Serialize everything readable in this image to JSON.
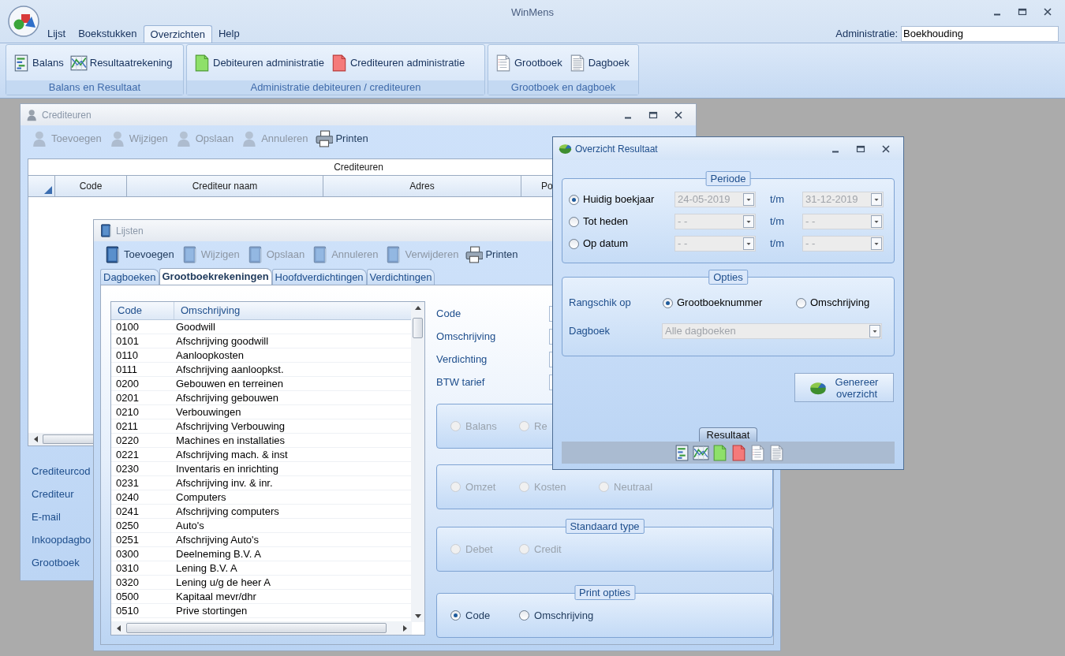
{
  "app": {
    "title": "WinMens"
  },
  "menu": [
    {
      "label": "Lijst",
      "selected": false
    },
    {
      "label": "Boekstukken",
      "selected": false
    },
    {
      "label": "Overzichten",
      "selected": true
    },
    {
      "label": "Help",
      "selected": false
    }
  ],
  "administratie": {
    "label": "Administratie:",
    "value": "Boekhouding"
  },
  "ribbon": [
    {
      "title": "Balans en Resultaat",
      "buttons": [
        {
          "label": "Balans",
          "kind": "ledger"
        },
        {
          "label": "Resultaatrekening",
          "kind": "chart"
        }
      ]
    },
    {
      "title": "Administratie debiteuren / crediteuren",
      "buttons": [
        {
          "label": "Debiteuren administratie",
          "kind": "green-doc"
        },
        {
          "label": "Crediteuren administratie",
          "kind": "red-doc"
        }
      ]
    },
    {
      "title": "Grootboek en dagboek",
      "buttons": [
        {
          "label": "Grootboek",
          "kind": "list-doc"
        },
        {
          "label": "Dagboek",
          "kind": "text-doc"
        }
      ]
    }
  ],
  "crediteuren_window": {
    "title": "Crediteuren",
    "toolbar": [
      {
        "label": "Toevoegen",
        "kind": "person",
        "disabled": true
      },
      {
        "label": "Wijzigen",
        "kind": "person",
        "disabled": true
      },
      {
        "label": "Opslaan",
        "kind": "person",
        "disabled": true
      },
      {
        "label": "Annuleren",
        "kind": "person",
        "disabled": true
      },
      {
        "label": "Printen",
        "kind": "printer",
        "disabled": false
      }
    ],
    "grid": {
      "title": "Crediteuren",
      "columns": [
        "Code",
        "Crediteur naam",
        "Adres",
        "Po"
      ]
    },
    "fields": [
      "Crediteurcod",
      "Crediteur",
      "E-mail",
      "Inkoopdagbo",
      "Grootboek"
    ]
  },
  "lijsten_window": {
    "title": "Lijsten",
    "toolbar": [
      {
        "label": "Toevoegen",
        "kind": "book",
        "disabled": false
      },
      {
        "label": "Wijzigen",
        "kind": "book",
        "disabled": true
      },
      {
        "label": "Opslaan",
        "kind": "book",
        "disabled": true
      },
      {
        "label": "Annuleren",
        "kind": "book",
        "disabled": true
      },
      {
        "label": "Verwijderen",
        "kind": "book",
        "disabled": true
      },
      {
        "label": "Printen",
        "kind": "printer",
        "disabled": false
      }
    ],
    "tabs": [
      {
        "label": "Dagboeken",
        "selected": false
      },
      {
        "label": "Grootboekrekeningen",
        "selected": true
      },
      {
        "label": "Hoofdverdichtingen",
        "selected": false
      },
      {
        "label": "Verdichtingen",
        "selected": false
      }
    ],
    "list": {
      "columns": [
        "Code",
        "Omschrijving"
      ],
      "rows": [
        {
          "code": "0100",
          "description": "Goodwill"
        },
        {
          "code": "0101",
          "description": "Afschrijving goodwill"
        },
        {
          "code": "0110",
          "description": "Aanloopkosten"
        },
        {
          "code": "0111",
          "description": "Afschrijving aanloopkst."
        },
        {
          "code": "0200",
          "description": "Gebouwen en terreinen"
        },
        {
          "code": "0201",
          "description": "Afschrijving gebouwen"
        },
        {
          "code": "0210",
          "description": "Verbouwingen"
        },
        {
          "code": "0211",
          "description": "Afschrijving Verbouwing"
        },
        {
          "code": "0220",
          "description": "Machines en installaties"
        },
        {
          "code": "0221",
          "description": "Afschrijving mach. & inst"
        },
        {
          "code": "0230",
          "description": "Inventaris en inrichting"
        },
        {
          "code": "0231",
          "description": "Afschrijving inv. & inr."
        },
        {
          "code": "0240",
          "description": "Computers"
        },
        {
          "code": "0241",
          "description": "Afschrijving computers"
        },
        {
          "code": "0250",
          "description": "Auto's"
        },
        {
          "code": "0251",
          "description": "Afschrijving Auto's"
        },
        {
          "code": "0300",
          "description": "Deelneming B.V. A"
        },
        {
          "code": "0310",
          "description": "Lening B.V. A"
        },
        {
          "code": "0320",
          "description": "Lening u/g de heer A"
        },
        {
          "code": "0500",
          "description": "Kapitaal mevr/dhr"
        },
        {
          "code": "0510",
          "description": "Prive stortingen"
        }
      ]
    },
    "form_labels": [
      "Code",
      "Omschrijving",
      "Verdichting",
      "BTW tarief"
    ],
    "groups": [
      {
        "options": [
          {
            "label": "Balans",
            "selected": false,
            "disabled": true
          },
          {
            "label": "Re",
            "selected": false,
            "disabled": true
          }
        ]
      },
      {
        "options": [
          {
            "label": "Omzet",
            "selected": false,
            "disabled": true
          },
          {
            "label": "Kosten",
            "selected": false,
            "disabled": true
          },
          {
            "label": "Neutraal",
            "selected": false,
            "disabled": true
          }
        ]
      },
      {
        "legend": "Standaard type",
        "options": [
          {
            "label": "Debet",
            "selected": false,
            "disabled": true
          },
          {
            "label": "Credit",
            "selected": false,
            "disabled": true
          }
        ]
      },
      {
        "legend": "Print opties",
        "options": [
          {
            "label": "Code",
            "selected": true,
            "disabled": false
          },
          {
            "label": "Omschrijving",
            "selected": false,
            "disabled": false
          }
        ]
      }
    ]
  },
  "overzicht_window": {
    "title": "Overzicht Resultaat",
    "periode": {
      "legend": "Periode",
      "rows": [
        {
          "label": "Huidig boekjaar",
          "selected": true,
          "from": "24-05-2019",
          "to_label": "t/m",
          "to": "31-12-2019",
          "disabled": true
        },
        {
          "label": "Tot heden",
          "selected": false,
          "from": "- -",
          "to_label": "t/m",
          "to": "- -",
          "disabled": true
        },
        {
          "label": "Op datum",
          "selected": false,
          "from": "- -",
          "to_label": "t/m",
          "to": "- -",
          "disabled": true
        }
      ]
    },
    "opties": {
      "legend": "Opties",
      "sort_label": "Rangschik op",
      "sort_options": [
        {
          "label": "Grootboeknummer",
          "selected": true
        },
        {
          "label": "Omschrijving",
          "selected": false
        }
      ],
      "dagboek_label": "Dagboek",
      "dagboek": {
        "value": "Alle dagboeken",
        "disabled": true
      }
    },
    "generate_button": "Genereer overzicht",
    "result_tab": "Resultaat"
  }
}
